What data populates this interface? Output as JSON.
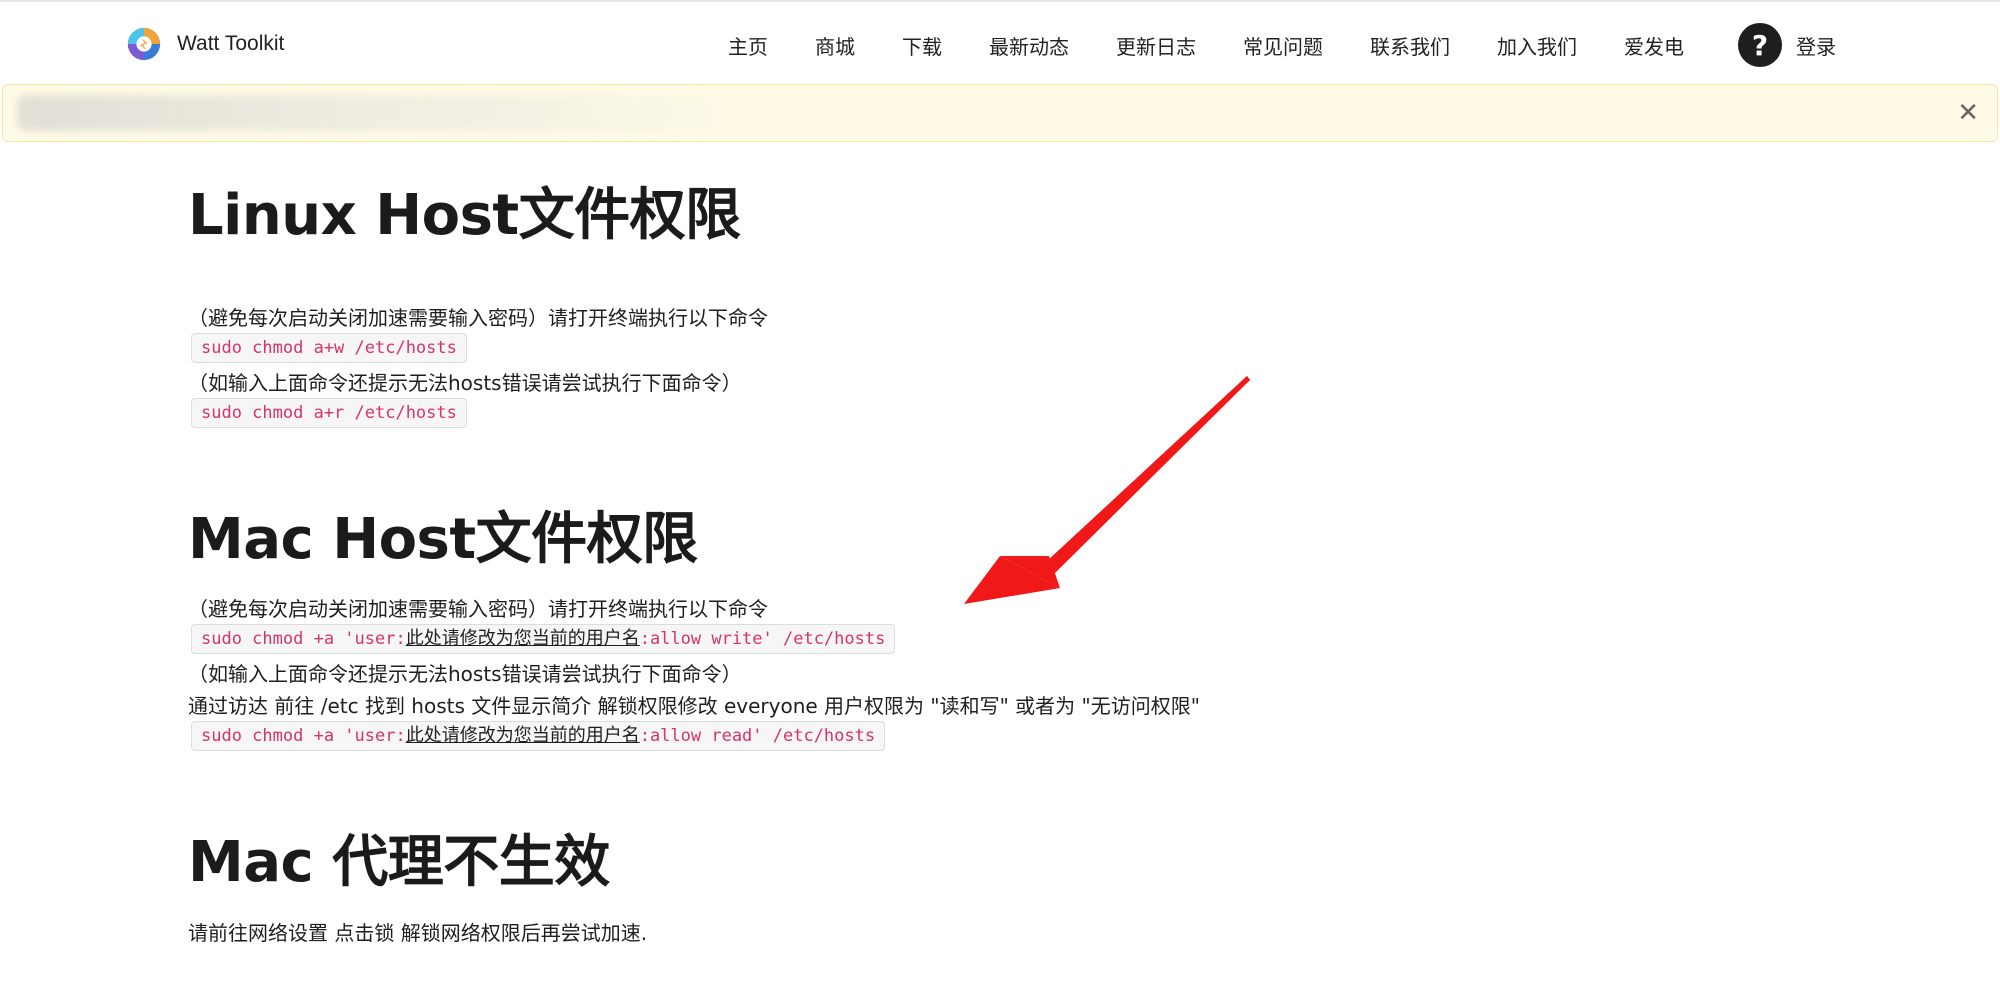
{
  "brand": {
    "name": "Watt Toolkit"
  },
  "nav": {
    "items": [
      "主页",
      "商城",
      "下载",
      "最新动态",
      "更新日志",
      "常见问题",
      "联系我们",
      "加入我们",
      "爱发电"
    ],
    "help_icon": "?",
    "login_label": "登录"
  },
  "notice": {
    "close_icon": "✕"
  },
  "sections": {
    "linux": {
      "title": "Linux Host文件权限",
      "line1": "（避免每次启动关闭加速需要输入密码）请打开终端执行以下命令",
      "cmd1": "sudo chmod a+w /etc/hosts",
      "line2": "（如输入上面命令还提示无法hosts错误请尝试执行下面命令）",
      "cmd2": "sudo chmod a+r /etc/hosts"
    },
    "mac": {
      "title": "Mac Host文件权限",
      "line1": "（避免每次启动关闭加速需要输入密码）请打开终端执行以下命令",
      "cmd1_pre": "sudo chmod +a 'user:",
      "cmd1_user": "此处请修改为您当前的用户名",
      "cmd1_post": ":allow write' /etc/hosts",
      "line2": "（如输入上面命令还提示无法hosts错误请尝试执行下面命令）",
      "line3": "通过访达 前往 /etc 找到 hosts 文件显示简介 解锁权限修改 everyone 用户权限为 \"读和写\" 或者为 \"无访问权限\"",
      "cmd2_pre": "sudo chmod +a 'user:",
      "cmd2_user": "此处请修改为您当前的用户名",
      "cmd2_post": ":allow read' /etc/hosts"
    },
    "proxy": {
      "title": "Mac 代理不生效",
      "line1": "请前往网络设置 点击锁 解锁网络权限后再尝试加速."
    }
  },
  "colors": {
    "code_text": "#d6336c",
    "notice_bg": "#fffbe6",
    "arrow": "#f01818"
  }
}
